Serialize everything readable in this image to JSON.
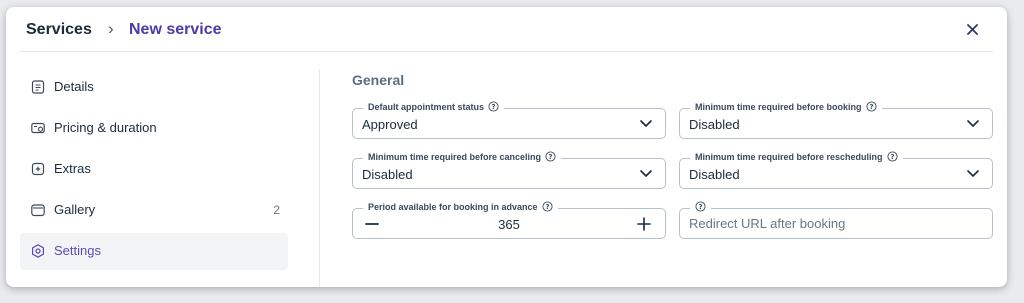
{
  "breadcrumb": {
    "root": "Services",
    "separator": "›",
    "current": "New service"
  },
  "sidebar": {
    "items": [
      {
        "label": "Details",
        "icon": "details-icon",
        "count": "",
        "active": false
      },
      {
        "label": "Pricing & duration",
        "icon": "pricing-icon",
        "count": "",
        "active": false
      },
      {
        "label": "Extras",
        "icon": "extras-icon",
        "count": "",
        "active": false
      },
      {
        "label": "Gallery",
        "icon": "gallery-icon",
        "count": "2",
        "active": false
      },
      {
        "label": "Settings",
        "icon": "settings-icon",
        "count": "",
        "active": true
      }
    ]
  },
  "main": {
    "section_title": "General",
    "fields": {
      "default_status": {
        "label": "Default appointment status",
        "value": "Approved"
      },
      "min_before_booking": {
        "label": "Minimum time required before booking",
        "value": "Disabled"
      },
      "min_before_canceling": {
        "label": "Minimum time required before canceling",
        "value": "Disabled"
      },
      "min_before_rescheduling": {
        "label": "Minimum time required before rescheduling",
        "value": "Disabled"
      },
      "period_in_advance": {
        "label": "Period available for booking in advance",
        "value": "365"
      },
      "redirect_url": {
        "label": "",
        "placeholder": "Redirect URL after booking",
        "value": ""
      }
    }
  },
  "colors": {
    "accent": "#4b3ba8",
    "active_bg": "#f3f4f6",
    "border": "#b9c2cc"
  }
}
